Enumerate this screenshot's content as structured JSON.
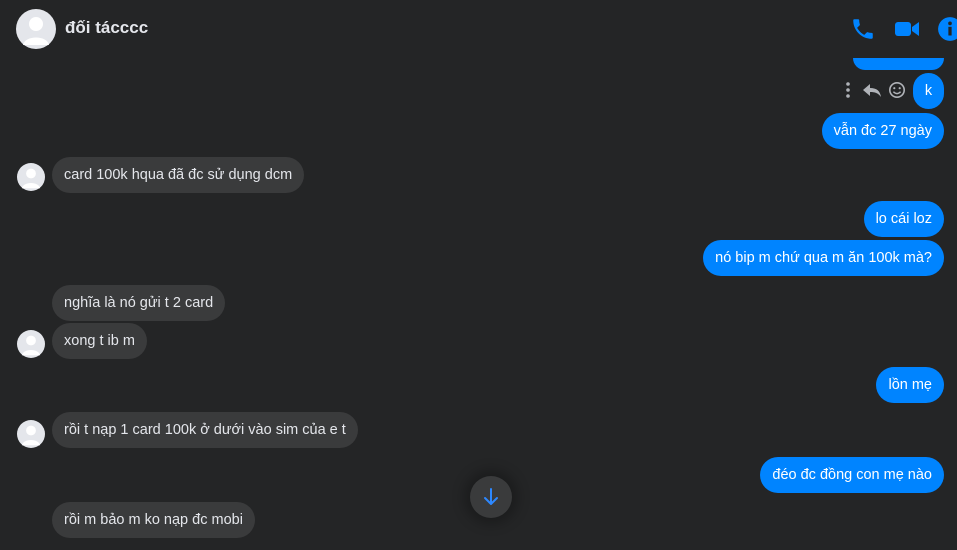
{
  "header": {
    "contact_name": "đối tácccc",
    "avatar_icon": "person-avatar-icon",
    "call_icon": "phone-icon",
    "video_icon": "video-camera-icon",
    "info_icon": "info-icon"
  },
  "colors": {
    "accent": "#0084ff",
    "background": "#242526",
    "incoming_bubble": "#3a3b3c",
    "text": "#e4e6eb"
  },
  "message_actions": {
    "more_icon": "more-vertical-icon",
    "reply_icon": "reply-icon",
    "react_icon": "smiley-icon"
  },
  "messages": [
    {
      "side": "out",
      "text": "k"
    },
    {
      "side": "out",
      "text": "vẫn đc 27 ngày"
    },
    {
      "side": "in",
      "text": "card 100k hqua đã đc sử dụng dcm"
    },
    {
      "side": "out",
      "text": "lo cái loz"
    },
    {
      "side": "out",
      "text": "nó bip m chứ qua m ăn 100k mà?"
    },
    {
      "side": "in",
      "text": "nghĩa là nó gửi t 2 card"
    },
    {
      "side": "in",
      "text": "xong t ib m"
    },
    {
      "side": "out",
      "text": "lồn mẹ"
    },
    {
      "side": "in",
      "text": "rồi t nạp 1 card 100k ở dưới vào sim của e t"
    },
    {
      "side": "out",
      "text": "đéo đc đồng con mẹ nào"
    },
    {
      "side": "in",
      "text": "rồi m bảo m ko nạp đc mobi"
    }
  ],
  "scroll_button_icon": "arrow-down-icon"
}
